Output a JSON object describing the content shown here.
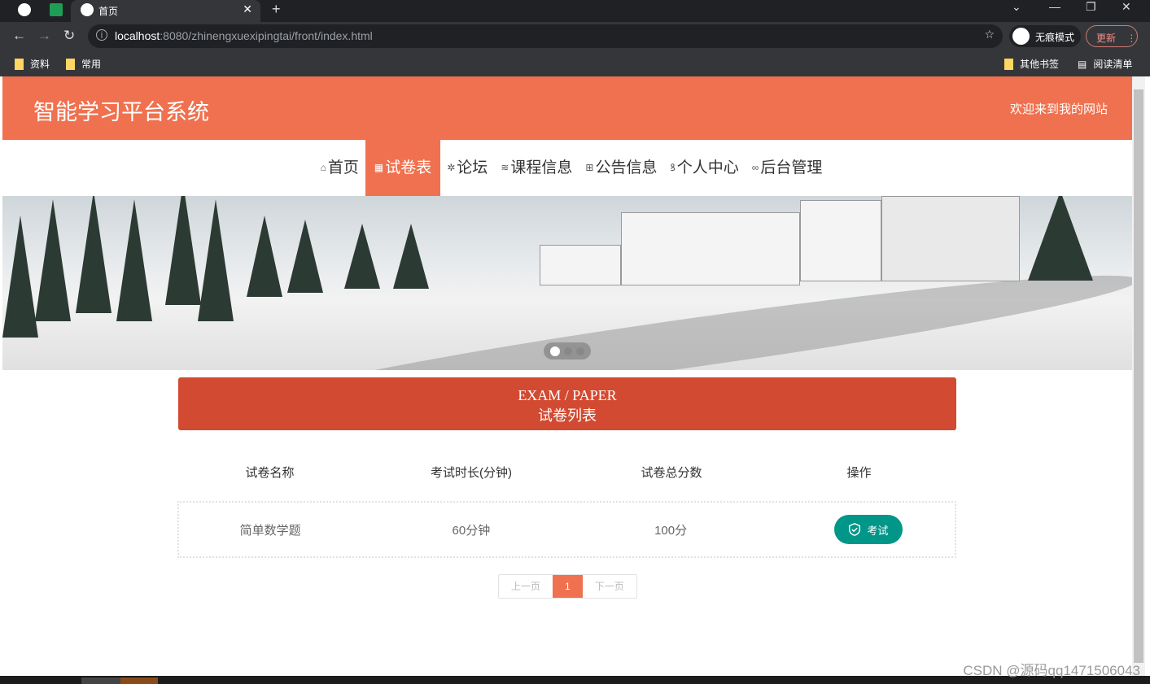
{
  "browser": {
    "tab_title": "首页",
    "url_host": "localhost",
    "url_path": ":8080/zhinengxuexipingtai/front/index.html",
    "incognito_label": "无痕模式",
    "update_label": "更新",
    "bookmarks": [
      "资料",
      "常用"
    ],
    "other_bookmarks": "其他书签",
    "reading_list": "阅读清单"
  },
  "header": {
    "title": "智能学习平台系统",
    "welcome": "欢迎来到我的网站"
  },
  "menu": [
    {
      "icon": "home-icon",
      "glyph": "⌂",
      "label": "首页"
    },
    {
      "icon": "paper-icon",
      "glyph": "▦",
      "label": "试卷表",
      "active": true
    },
    {
      "icon": "forum-icon",
      "glyph": "✲",
      "label": "论坛"
    },
    {
      "icon": "layers-icon",
      "glyph": "≋",
      "label": "课程信息"
    },
    {
      "icon": "gift-icon",
      "glyph": "⊞",
      "label": "公告信息"
    },
    {
      "icon": "user-icon",
      "glyph": "ꝸ",
      "label": "个人中心"
    },
    {
      "icon": "link-icon",
      "glyph": "∞",
      "label": "后台管理"
    }
  ],
  "banner": {
    "slides": 3,
    "active_slide": 1
  },
  "section": {
    "title_en": "EXAM / PAPER",
    "title_zh": "试卷列表"
  },
  "table": {
    "headers": [
      "试卷名称",
      "考试时长(分钟)",
      "试卷总分数",
      "操作"
    ],
    "rows": [
      {
        "name": "简单数学题",
        "duration": "60分钟",
        "score": "100分",
        "action": "考试"
      }
    ]
  },
  "pager": {
    "prev": "上一页",
    "current": "1",
    "next": "下一页"
  },
  "watermark": "CSDN @源码qq1471506043",
  "colors": {
    "primary": "#f0714f",
    "section": "#d24a31",
    "action": "#009688"
  }
}
